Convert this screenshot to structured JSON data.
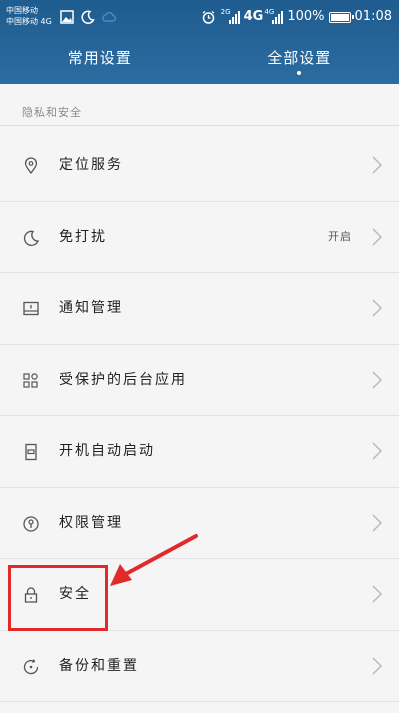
{
  "status_bar": {
    "carrier_1": "中国移动",
    "carrier_2": "中国移动",
    "carrier_2_network": "4G",
    "sim1_network": "2G",
    "network_big": "4G",
    "sim2_network": "4G",
    "battery": "100%",
    "time": "01:08",
    "icons": [
      "image-icon",
      "moon-icon",
      "cloud-icon",
      "alarm-icon",
      "signal-icon",
      "battery-icon"
    ]
  },
  "tabs": [
    {
      "label": "常用设置",
      "active": false
    },
    {
      "label": "全部设置",
      "active": true
    }
  ],
  "section": {
    "title": "隐私和安全"
  },
  "rows": [
    {
      "label": "定位服务",
      "value": "",
      "icon": "location-icon"
    },
    {
      "label": "免打扰",
      "value": "开启",
      "icon": "moon-icon"
    },
    {
      "label": "通知管理",
      "value": "",
      "icon": "notification-icon"
    },
    {
      "label": "受保护的后台应用",
      "value": "",
      "icon": "protected-apps-icon"
    },
    {
      "label": "开机自动启动",
      "value": "",
      "icon": "startup-icon"
    },
    {
      "label": "权限管理",
      "value": "",
      "icon": "permission-icon"
    },
    {
      "label": "安全",
      "value": "",
      "icon": "lock-icon"
    },
    {
      "label": "备份和重置",
      "value": "",
      "icon": "backup-icon"
    }
  ],
  "colors": {
    "header": "#2a679b",
    "annotation": "#e12a2a",
    "background": "#f5f5f5"
  }
}
